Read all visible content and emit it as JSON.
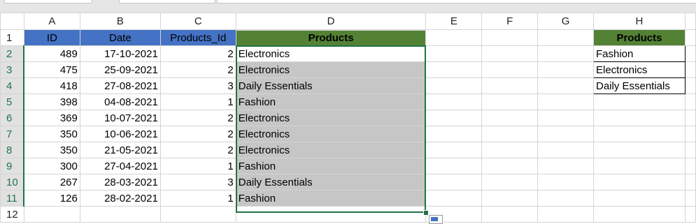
{
  "columns": [
    "A",
    "B",
    "C",
    "D",
    "E",
    "F",
    "G",
    "H"
  ],
  "rows": [
    "1",
    "2",
    "3",
    "4",
    "5",
    "6",
    "7",
    "8",
    "9",
    "10",
    "11",
    "12"
  ],
  "headers": {
    "id": "ID",
    "date": "Date",
    "products_id": "Products_Id",
    "products": "Products",
    "products2": "Products"
  },
  "data": [
    {
      "id": "489",
      "date": "17-10-2021",
      "pid": "2",
      "product": "Electronics"
    },
    {
      "id": "475",
      "date": "25-09-2021",
      "pid": "2",
      "product": "Electronics"
    },
    {
      "id": "418",
      "date": "27-08-2021",
      "pid": "3",
      "product": "Daily Essentials"
    },
    {
      "id": "398",
      "date": "04-08-2021",
      "pid": "1",
      "product": "Fashion"
    },
    {
      "id": "369",
      "date": "10-07-2021",
      "pid": "2",
      "product": "Electronics"
    },
    {
      "id": "350",
      "date": "10-06-2021",
      "pid": "2",
      "product": "Electronics"
    },
    {
      "id": "350",
      "date": "21-05-2021",
      "pid": "2",
      "product": "Electronics"
    },
    {
      "id": "300",
      "date": "27-04-2021",
      "pid": "1",
      "product": "Fashion"
    },
    {
      "id": "267",
      "date": "28-03-2021",
      "pid": "3",
      "product": "Daily Essentials"
    },
    {
      "id": "126",
      "date": "28-02-2021",
      "pid": "1",
      "product": "Fashion"
    }
  ],
  "lookup": [
    "Fashion",
    "Electronics",
    "Daily Essentials"
  ],
  "colors": {
    "header_blue": "#4472c4",
    "header_green": "#548235",
    "selection": "#217346",
    "selected_fill": "#c6c6c6"
  }
}
